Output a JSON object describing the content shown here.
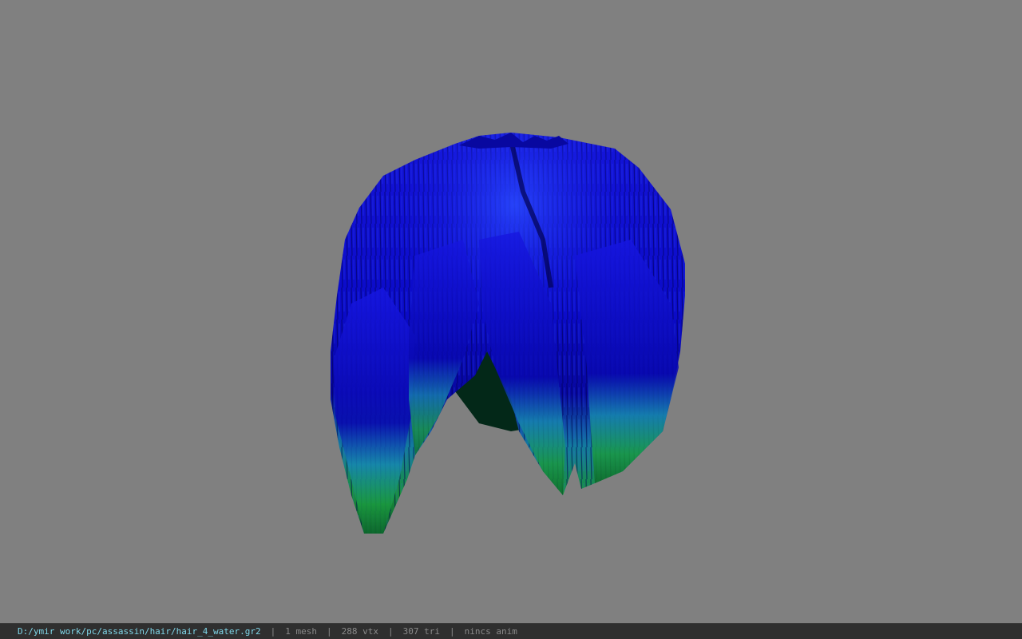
{
  "viewport": {
    "background_color": "#808080",
    "model_name": "hair_4_water",
    "hair_colors": {
      "top": "#1010e8",
      "mid": "#0a0ac0",
      "dark": "#020250",
      "tip_teal": "#18a0a0",
      "tip_green": "#1a8a30",
      "inner_dark": "#032818"
    }
  },
  "status_bar": {
    "file_path": "D:/ymir work/pc/assassin/hair/hair_4_water.gr2",
    "separator": "|",
    "mesh_count": "1 mesh",
    "vertex_count": "288 vtx",
    "triangle_count": "307 tri",
    "anim_status": "nincs anim"
  }
}
